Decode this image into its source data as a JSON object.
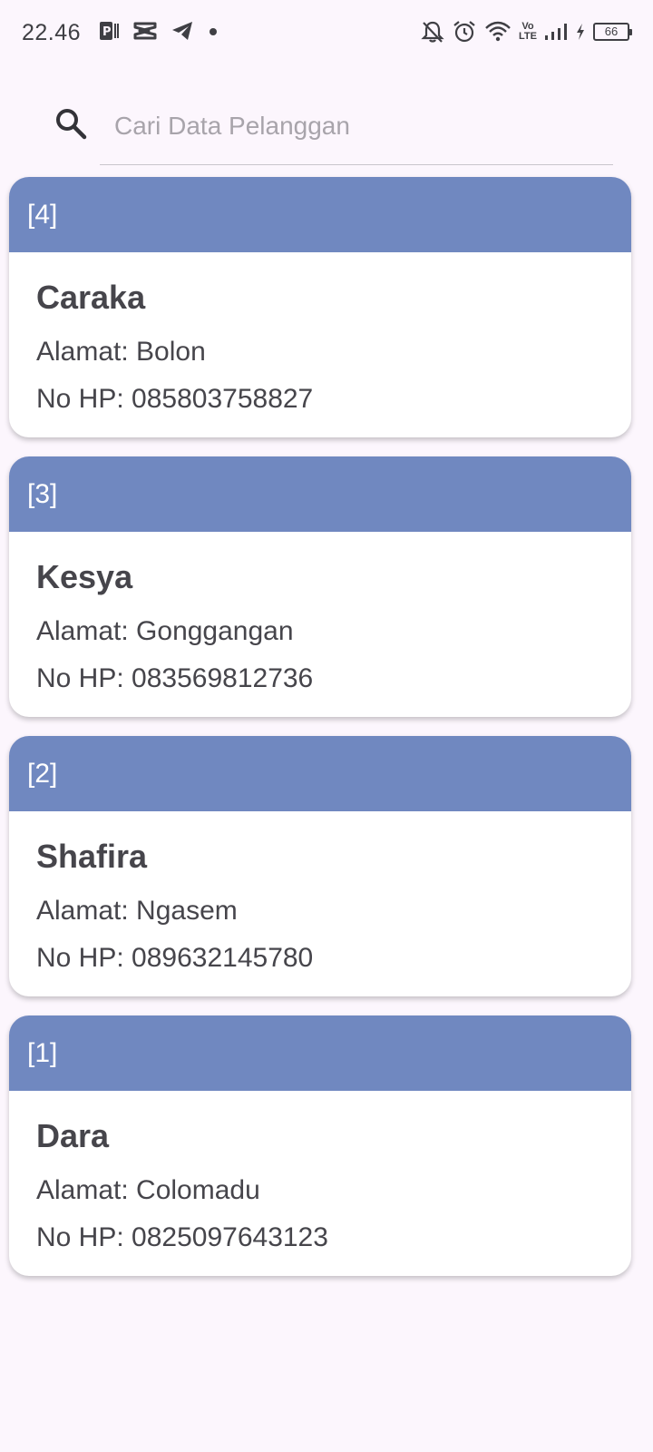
{
  "status_bar": {
    "time": "22.46",
    "volte_top": "Vo",
    "volte_bottom": "LTE",
    "battery": "66"
  },
  "search": {
    "placeholder": "Cari Data Pelanggan",
    "value": ""
  },
  "labels": {
    "address_prefix": "Alamat: ",
    "phone_prefix": "No HP: "
  },
  "customers": [
    {
      "id": "[4]",
      "name": "Caraka",
      "address": "Bolon",
      "phone": "085803758827"
    },
    {
      "id": "[3]",
      "name": "Kesya",
      "address": "Gonggangan",
      "phone": "083569812736"
    },
    {
      "id": "[2]",
      "name": "Shafira",
      "address": "Ngasem",
      "phone": "089632145780"
    },
    {
      "id": "[1]",
      "name": "Dara",
      "address": "Colomadu",
      "phone": "0825097643123"
    }
  ],
  "colors": {
    "card_header": "#7088c0",
    "background": "#fcf6fd",
    "text": "#46454b"
  }
}
